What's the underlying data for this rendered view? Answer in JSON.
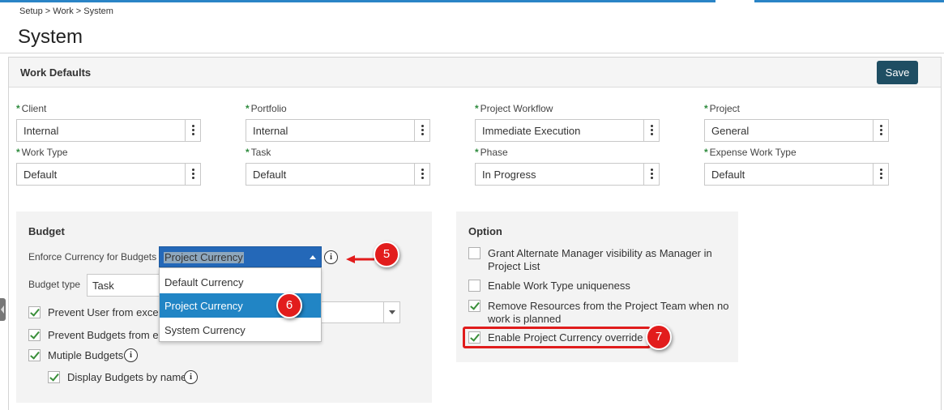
{
  "breadcrumb": "Setup > Work > System",
  "page_title": "System",
  "card": {
    "title": "Work Defaults",
    "save_label": "Save"
  },
  "fields": [
    {
      "label": "Client",
      "value": "Internal"
    },
    {
      "label": "Portfolio",
      "value": "Internal"
    },
    {
      "label": "Project Workflow",
      "value": "Immediate Execution"
    },
    {
      "label": "Project",
      "value": "General"
    },
    {
      "label": "Work Type",
      "value": "Default"
    },
    {
      "label": "Task",
      "value": "Default"
    },
    {
      "label": "Phase",
      "value": "In Progress"
    },
    {
      "label": "Expense Work Type",
      "value": "Default"
    }
  ],
  "budget": {
    "title": "Budget",
    "enforce_label": "Enforce Currency for Budgets",
    "enforce_value": "Project Currency",
    "enforce_options": [
      "Default Currency",
      "Project Currency",
      "System Currency"
    ],
    "type_label": "Budget type",
    "type_value": "Task",
    "checkboxes": [
      {
        "label": "Prevent User from exce",
        "checked": true
      },
      {
        "label": "Prevent Budgets from ex",
        "checked": true
      },
      {
        "label": "Mutiple Budgets",
        "checked": true
      },
      {
        "label": "Display Budgets by name",
        "checked": true
      }
    ]
  },
  "option": {
    "title": "Option",
    "checkboxes": [
      {
        "label_line1": "Grant Alternate Manager visibility as Manager in",
        "label_line2": "Project List",
        "checked": false
      },
      {
        "label_line1": "Enable Work Type uniqueness",
        "label_line2": "",
        "checked": false
      },
      {
        "label_line1": "Remove Resources from the Project Team when no",
        "label_line2": "work is planned",
        "checked": true
      },
      {
        "label_line1": "Enable Project Currency override",
        "label_line2": "",
        "checked": true
      }
    ]
  },
  "callouts": [
    "5",
    "6",
    "7"
  ],
  "icons": {
    "info": "i"
  }
}
